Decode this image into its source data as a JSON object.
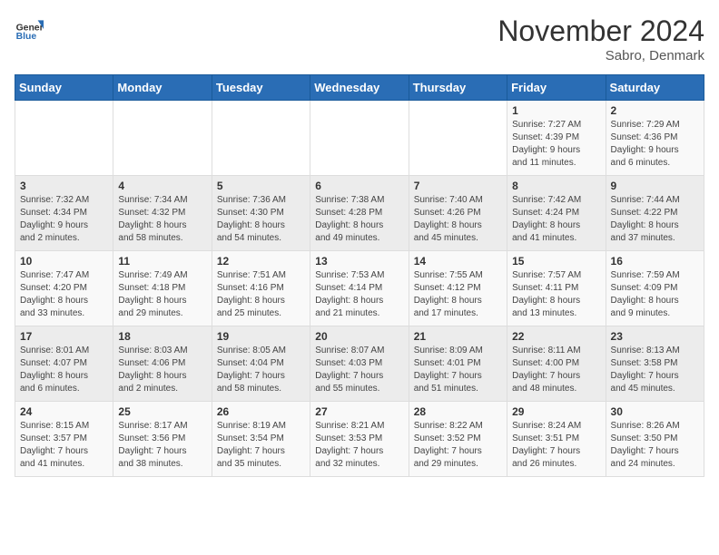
{
  "header": {
    "logo_general": "General",
    "logo_blue": "Blue",
    "title": "November 2024",
    "location": "Sabro, Denmark"
  },
  "weekdays": [
    "Sunday",
    "Monday",
    "Tuesday",
    "Wednesday",
    "Thursday",
    "Friday",
    "Saturday"
  ],
  "weeks": [
    [
      {
        "day": "",
        "info": ""
      },
      {
        "day": "",
        "info": ""
      },
      {
        "day": "",
        "info": ""
      },
      {
        "day": "",
        "info": ""
      },
      {
        "day": "",
        "info": ""
      },
      {
        "day": "1",
        "info": "Sunrise: 7:27 AM\nSunset: 4:39 PM\nDaylight: 9 hours\nand 11 minutes."
      },
      {
        "day": "2",
        "info": "Sunrise: 7:29 AM\nSunset: 4:36 PM\nDaylight: 9 hours\nand 6 minutes."
      }
    ],
    [
      {
        "day": "3",
        "info": "Sunrise: 7:32 AM\nSunset: 4:34 PM\nDaylight: 9 hours\nand 2 minutes."
      },
      {
        "day": "4",
        "info": "Sunrise: 7:34 AM\nSunset: 4:32 PM\nDaylight: 8 hours\nand 58 minutes."
      },
      {
        "day": "5",
        "info": "Sunrise: 7:36 AM\nSunset: 4:30 PM\nDaylight: 8 hours\nand 54 minutes."
      },
      {
        "day": "6",
        "info": "Sunrise: 7:38 AM\nSunset: 4:28 PM\nDaylight: 8 hours\nand 49 minutes."
      },
      {
        "day": "7",
        "info": "Sunrise: 7:40 AM\nSunset: 4:26 PM\nDaylight: 8 hours\nand 45 minutes."
      },
      {
        "day": "8",
        "info": "Sunrise: 7:42 AM\nSunset: 4:24 PM\nDaylight: 8 hours\nand 41 minutes."
      },
      {
        "day": "9",
        "info": "Sunrise: 7:44 AM\nSunset: 4:22 PM\nDaylight: 8 hours\nand 37 minutes."
      }
    ],
    [
      {
        "day": "10",
        "info": "Sunrise: 7:47 AM\nSunset: 4:20 PM\nDaylight: 8 hours\nand 33 minutes."
      },
      {
        "day": "11",
        "info": "Sunrise: 7:49 AM\nSunset: 4:18 PM\nDaylight: 8 hours\nand 29 minutes."
      },
      {
        "day": "12",
        "info": "Sunrise: 7:51 AM\nSunset: 4:16 PM\nDaylight: 8 hours\nand 25 minutes."
      },
      {
        "day": "13",
        "info": "Sunrise: 7:53 AM\nSunset: 4:14 PM\nDaylight: 8 hours\nand 21 minutes."
      },
      {
        "day": "14",
        "info": "Sunrise: 7:55 AM\nSunset: 4:12 PM\nDaylight: 8 hours\nand 17 minutes."
      },
      {
        "day": "15",
        "info": "Sunrise: 7:57 AM\nSunset: 4:11 PM\nDaylight: 8 hours\nand 13 minutes."
      },
      {
        "day": "16",
        "info": "Sunrise: 7:59 AM\nSunset: 4:09 PM\nDaylight: 8 hours\nand 9 minutes."
      }
    ],
    [
      {
        "day": "17",
        "info": "Sunrise: 8:01 AM\nSunset: 4:07 PM\nDaylight: 8 hours\nand 6 minutes."
      },
      {
        "day": "18",
        "info": "Sunrise: 8:03 AM\nSunset: 4:06 PM\nDaylight: 8 hours\nand 2 minutes."
      },
      {
        "day": "19",
        "info": "Sunrise: 8:05 AM\nSunset: 4:04 PM\nDaylight: 7 hours\nand 58 minutes."
      },
      {
        "day": "20",
        "info": "Sunrise: 8:07 AM\nSunset: 4:03 PM\nDaylight: 7 hours\nand 55 minutes."
      },
      {
        "day": "21",
        "info": "Sunrise: 8:09 AM\nSunset: 4:01 PM\nDaylight: 7 hours\nand 51 minutes."
      },
      {
        "day": "22",
        "info": "Sunrise: 8:11 AM\nSunset: 4:00 PM\nDaylight: 7 hours\nand 48 minutes."
      },
      {
        "day": "23",
        "info": "Sunrise: 8:13 AM\nSunset: 3:58 PM\nDaylight: 7 hours\nand 45 minutes."
      }
    ],
    [
      {
        "day": "24",
        "info": "Sunrise: 8:15 AM\nSunset: 3:57 PM\nDaylight: 7 hours\nand 41 minutes."
      },
      {
        "day": "25",
        "info": "Sunrise: 8:17 AM\nSunset: 3:56 PM\nDaylight: 7 hours\nand 38 minutes."
      },
      {
        "day": "26",
        "info": "Sunrise: 8:19 AM\nSunset: 3:54 PM\nDaylight: 7 hours\nand 35 minutes."
      },
      {
        "day": "27",
        "info": "Sunrise: 8:21 AM\nSunset: 3:53 PM\nDaylight: 7 hours\nand 32 minutes."
      },
      {
        "day": "28",
        "info": "Sunrise: 8:22 AM\nSunset: 3:52 PM\nDaylight: 7 hours\nand 29 minutes."
      },
      {
        "day": "29",
        "info": "Sunrise: 8:24 AM\nSunset: 3:51 PM\nDaylight: 7 hours\nand 26 minutes."
      },
      {
        "day": "30",
        "info": "Sunrise: 8:26 AM\nSunset: 3:50 PM\nDaylight: 7 hours\nand 24 minutes."
      }
    ]
  ]
}
